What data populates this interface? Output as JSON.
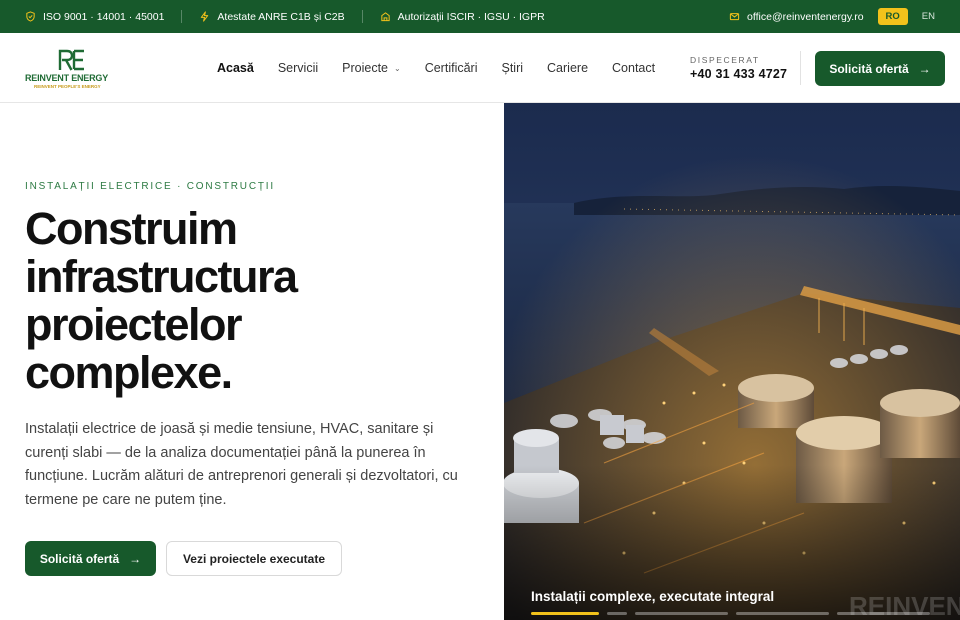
{
  "topbar": {
    "cert_iso": "ISO 9001 · 14001 · 45001",
    "cert_anre": "Atestate ANRE C1B și C2B",
    "cert_auth": "Autorizații ISCIR · IGSU · IGPR",
    "email": "office@reinventenergy.ro",
    "lang_active": "RO",
    "lang_other": "EN"
  },
  "header": {
    "logo_mark": "RE",
    "logo_name": "REINVENT ENERGY",
    "logo_tagline": "REINVENT PEOPLE'S ENERGY",
    "nav": [
      {
        "label": "Acasă"
      },
      {
        "label": "Servicii"
      },
      {
        "label": "Proiecte"
      },
      {
        "label": "Certificări"
      },
      {
        "label": "Știri"
      },
      {
        "label": "Cariere"
      },
      {
        "label": "Contact"
      }
    ],
    "dispatch_label": "DISPECERAT",
    "dispatch_phone": "+40 31 433 4727",
    "cta_label": "Solicită ofertă"
  },
  "hero": {
    "eyebrow": "INSTALAȚII ELECTRICE · CONSTRUCȚII",
    "headline_1": "Construim",
    "headline_2": "infrastructura",
    "headline_3": "proiectelor",
    "headline_4": "complexe.",
    "lead": "Instalații electrice de joasă și medie tensiune, HVAC, sanitare și curenți slabi — de la analiza documentației până la punerea în funcțiune. Lucrăm alături de antreprenori generali și dezvoltatori, cu termene pe care ne putem ține.",
    "cta_primary": "Solicită ofertă",
    "cta_secondary": "Vezi proiectele executate",
    "slide_caption": "Instalații complexe, executate integral",
    "image_watermark": "REINVENT",
    "slides_total": 5,
    "slide_active": 1
  },
  "colors": {
    "brand_green": "#17592b",
    "accent_yellow": "#f2c21b"
  }
}
